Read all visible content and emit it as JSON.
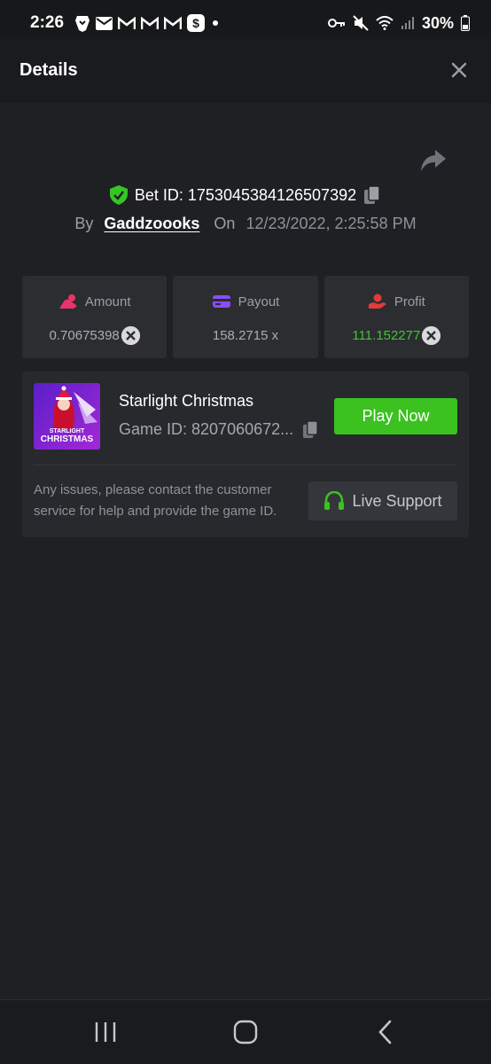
{
  "status_bar": {
    "time": "2:26",
    "battery": "30%",
    "left_icons": [
      "brave-icon",
      "mail-icon",
      "gmail-icon",
      "gmail-icon",
      "gmail-icon",
      "cash-app-icon",
      "dot-icon"
    ],
    "right_icons": [
      "key-icon",
      "mute-icon",
      "wifi-icon",
      "signal-icon",
      "battery-icon"
    ]
  },
  "header": {
    "title": "Details"
  },
  "bet": {
    "bet_id": "Bet ID: 1753045384126507392",
    "by_label": "By",
    "username": "Gaddzoooks",
    "on_label": "On",
    "date": "12/23/2022, 2:25:58 PM"
  },
  "stats": {
    "amount": {
      "label": "Amount",
      "value": "0.70675398"
    },
    "payout": {
      "label": "Payout",
      "value": "158.2715 x"
    },
    "profit": {
      "label": "Profit",
      "value": "111.152277"
    }
  },
  "game": {
    "title": "Starlight Christmas",
    "game_id": "Game ID: 8207060672...",
    "thumb_line1": "STARLIGHT",
    "thumb_line2": "CHRISTMAS",
    "play_label": "Play Now",
    "help_text": "Any issues, please contact the customer service for help and provide the game ID.",
    "support_label": "Live Support"
  },
  "colors": {
    "accent_green": "#3bc120",
    "profit_green": "#3fc630",
    "amount_pink": "#e8346a",
    "payout_purple": "#8a4cf7",
    "profit_red": "#e23b3b",
    "shield_green": "#34c724"
  }
}
